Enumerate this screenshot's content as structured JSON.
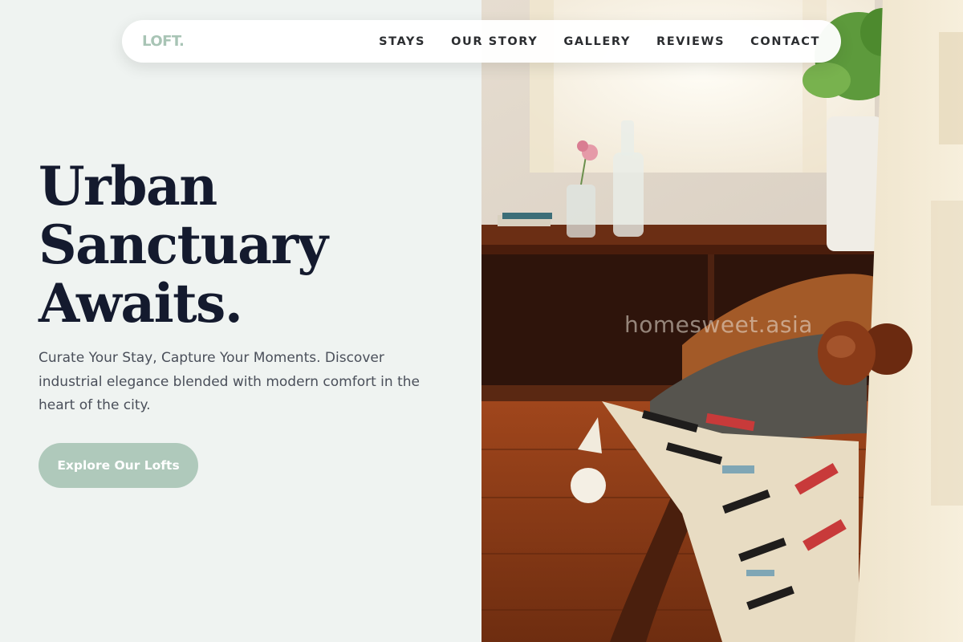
{
  "brand": {
    "logo": "LOFT."
  },
  "nav": {
    "items": [
      {
        "label": "STAYS"
      },
      {
        "label": "OUR STORY"
      },
      {
        "label": "GALLERY"
      },
      {
        "label": "REVIEWS"
      },
      {
        "label": "CONTACT"
      }
    ]
  },
  "hero": {
    "title_lines": [
      "Urban",
      "Sanctuary",
      "Awaits."
    ],
    "subtitle": "Curate Your Stay, Capture Your Moments. Discover industrial elegance blended with modern comfort in the heart of the city.",
    "cta_label": "Explore Our Lofts"
  },
  "photo": {
    "watermark": "homesweet.asia"
  },
  "colors": {
    "background": "#eff3f1",
    "accent": "#afc9bb",
    "logo": "#a8c4b5",
    "heading": "#141a2e",
    "body_text": "#4a4f5a"
  }
}
